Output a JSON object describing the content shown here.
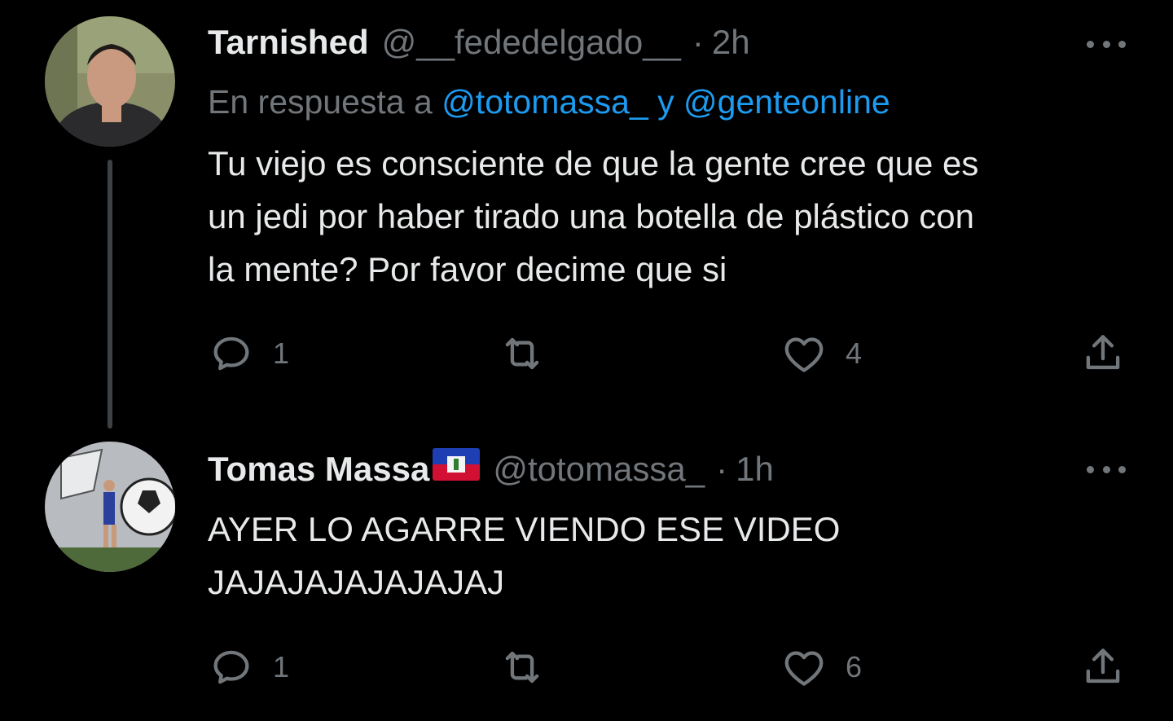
{
  "tweets": [
    {
      "name": "Tarnished",
      "handle": "@__fededelgado__",
      "separator": "·",
      "time": "2h",
      "replying_prefix": "En respuesta a ",
      "replying_mentions": "@totomassa_ y @genteonline",
      "text": "Tu viejo es consciente de que la gente cree que es\nun jedi por haber tirado una botella de plástico con\nla mente? Por favor decime que si",
      "reply_count": "1",
      "like_count": "4"
    },
    {
      "name": "Tomas Massa",
      "flag": "haiti-flag",
      "handle": "@totomassa_",
      "separator": "·",
      "time": "1h",
      "text": "AYER LO AGARRE VIENDO ESE VIDEO\nJAJAJAJAJAJAJAJ",
      "reply_count": "1",
      "like_count": "6"
    }
  ],
  "icons": {
    "reply": "reply-icon",
    "retweet": "retweet-icon",
    "like": "heart-icon",
    "share": "share-icon",
    "more": "more-icon"
  },
  "colors": {
    "background": "#000000",
    "text_primary": "#e7e9ea",
    "text_secondary": "#71767b",
    "accent": "#1d9bf0"
  }
}
